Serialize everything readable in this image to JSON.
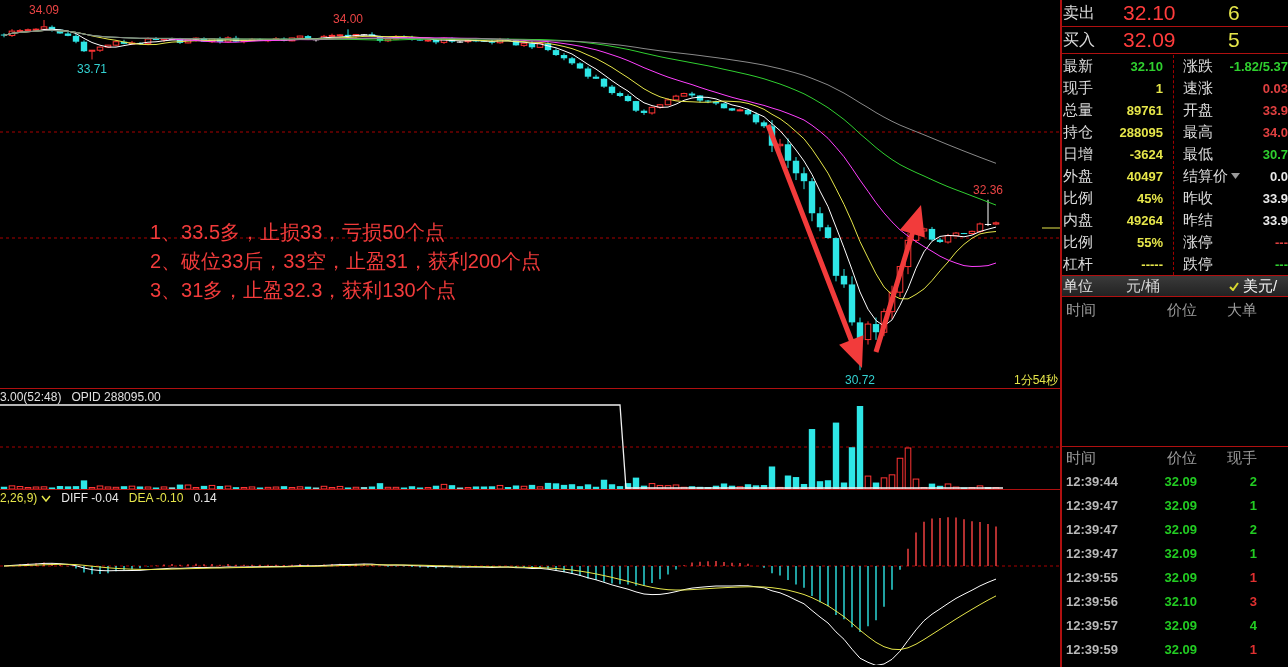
{
  "main_chart": {
    "price_markers": [
      {
        "text": "34.09",
        "kind": "high"
      },
      {
        "text": "33.71",
        "kind": "low"
      },
      {
        "text": "34.00",
        "kind": "high"
      },
      {
        "text": "32.36",
        "kind": "high"
      },
      {
        "text": "30.72",
        "kind": "low"
      }
    ],
    "notes": [
      "1、33.5多，止损33，亏损50个点",
      "2、破位33后，33空，止盈31，获利200个点",
      "3、31多，止盈32.3，获利130个点"
    ],
    "countdown": "1分54秒"
  },
  "volume_panel": {
    "legend": [
      "3.00(52:48)",
      "OPID 288095.00"
    ]
  },
  "macd_panel": {
    "params": {
      "text": "2,26,9)",
      "menu": true
    },
    "values": [
      {
        "text": "DIFF -0.04",
        "color": "#e8e8e8"
      },
      {
        "text": "DEA -0.10",
        "color": "#e6e64a"
      },
      {
        "text": "0.14",
        "color": "#e8e8e8"
      }
    ]
  },
  "order_book": [
    {
      "label": "卖出",
      "price": "32.10",
      "volume": "6"
    },
    {
      "label": "买入",
      "price": "32.09",
      "volume": "5"
    }
  ],
  "quote": {
    "left": [
      {
        "label": "最新",
        "value": "32.10",
        "color": "#2fd02f"
      },
      {
        "label": "现手",
        "value": "1",
        "color": "#e6e64a"
      },
      {
        "label": "总量",
        "value": "89761",
        "color": "#e6e64a"
      },
      {
        "label": "持仓",
        "value": "288095",
        "color": "#e6e64a"
      },
      {
        "label": "日增",
        "value": "-3624",
        "color": "#e6e64a"
      },
      {
        "label": "外盘",
        "value": "40497",
        "color": "#e6e64a"
      },
      {
        "label": "比例",
        "value": "45%",
        "color": "#e6e64a"
      },
      {
        "label": "内盘",
        "value": "49264",
        "color": "#e6e64a"
      },
      {
        "label": "比例",
        "value": "55%",
        "color": "#e6e64a"
      },
      {
        "label": "杠杆",
        "value": "-----",
        "color": "#e6e64a"
      }
    ],
    "right": [
      {
        "label": "涨跌",
        "value": "-1.82/5.37",
        "color": "#2fd02f",
        "dropdown": false
      },
      {
        "label": "速涨",
        "value": "0.03",
        "color": "#e04040",
        "dropdown": false
      },
      {
        "label": "开盘",
        "value": "33.9",
        "color": "#e04040",
        "dropdown": false
      },
      {
        "label": "最高",
        "value": "34.0",
        "color": "#e04040",
        "dropdown": false
      },
      {
        "label": "最低",
        "value": "30.7",
        "color": "#2fd02f",
        "dropdown": false
      },
      {
        "label": "结算价",
        "value": "0.0",
        "color": "#e8e8e8",
        "dropdown": true
      },
      {
        "label": "昨收",
        "value": "33.9",
        "color": "#e8e8e8",
        "dropdown": false
      },
      {
        "label": "昨结",
        "value": "33.9",
        "color": "#e8e8e8",
        "dropdown": false
      },
      {
        "label": "涨停",
        "value": "---",
        "color": "#e04040",
        "dropdown": false
      },
      {
        "label": "跌停",
        "value": "---",
        "color": "#2fd02f",
        "dropdown": false
      }
    ]
  },
  "units": {
    "label": "单位",
    "options": [
      {
        "label": "元/桶",
        "selected": false
      },
      {
        "label": "美元/",
        "selected": true
      }
    ]
  },
  "big_orders": {
    "columns": [
      "时间",
      "价位",
      "大单"
    ]
  },
  "ticks": {
    "columns": [
      "时间",
      "价位",
      "现手"
    ],
    "rows": [
      {
        "time": "12:39:44",
        "price": "32.09",
        "volume": "2",
        "color": "#22cc22"
      },
      {
        "time": "12:39:47",
        "price": "32.09",
        "volume": "1",
        "color": "#22cc22"
      },
      {
        "time": "12:39:47",
        "price": "32.09",
        "volume": "2",
        "color": "#22cc22"
      },
      {
        "time": "12:39:47",
        "price": "32.09",
        "volume": "1",
        "color": "#22cc22"
      },
      {
        "time": "12:39:55",
        "price": "32.09",
        "volume": "1",
        "color": "#e03030"
      },
      {
        "time": "12:39:56",
        "price": "32.10",
        "volume": "3",
        "color": "#e03030"
      },
      {
        "time": "12:39:57",
        "price": "32.09",
        "volume": "4",
        "color": "#22cc22"
      },
      {
        "time": "12:39:59",
        "price": "32.09",
        "volume": "1",
        "color": "#e03030"
      }
    ]
  }
}
